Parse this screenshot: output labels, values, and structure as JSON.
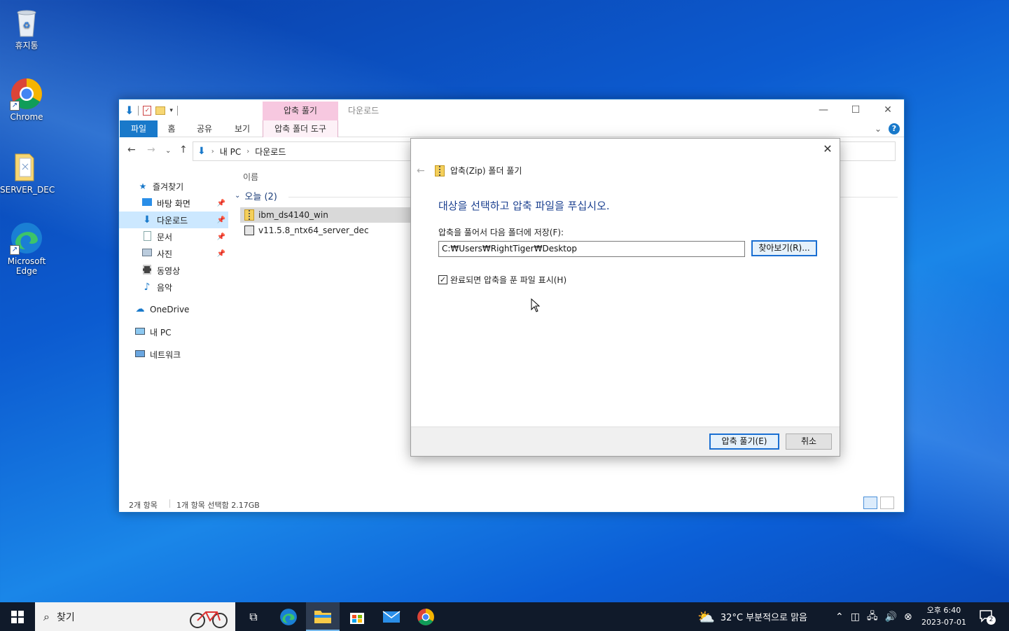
{
  "desktop": {
    "icons": [
      {
        "label": "휴지통"
      },
      {
        "label": "Chrome"
      },
      {
        "label": "SERVER_DEC"
      },
      {
        "label": "Microsoft Edge"
      }
    ]
  },
  "explorer": {
    "title": "다운로드",
    "context_tab_head": "압축 풀기",
    "tabs": {
      "file": "파일",
      "home": "홈",
      "share": "공유",
      "view": "보기",
      "context": "압축 폴더 도구"
    },
    "address": {
      "pc": "내 PC",
      "folder": "다운로드"
    },
    "nav": {
      "quick_access": "즐겨찾기",
      "desktop": "바탕 화면",
      "downloads": "다운로드",
      "documents": "문서",
      "pictures": "사진",
      "videos": "동영상",
      "music": "음악",
      "onedrive": "OneDrive",
      "this_pc": "내 PC",
      "network": "네트워크"
    },
    "column_name": "이름",
    "group_label": "오늘 (2)",
    "files": [
      {
        "name": "ibm_ds4140_win"
      },
      {
        "name": "v11.5.8_ntx64_server_dec"
      }
    ],
    "status": {
      "count": "2개 항목",
      "selection": "1개 항목 선택함 2.17GB"
    }
  },
  "dialog": {
    "title": "압축(Zip) 폴더 풀기",
    "heading": "대상을 선택하고 압축 파일을 푸십시오.",
    "path_label": "압축을 풀어서 다음 폴더에 저장(F):",
    "path_value": "C:₩Users₩RightTiger₩Desktop",
    "browse_label": "찾아보기(R)...",
    "checkbox_label": "완료되면 압축을 푼 파일 표시(H)",
    "checkbox_checked": true,
    "extract_label": "압축 풀기(E)",
    "cancel_label": "취소"
  },
  "taskbar": {
    "search_placeholder": "찾기",
    "weather": "32°C  부분적으로 맑음",
    "time": "오후 6:40",
    "date": "2023-07-01",
    "notification_count": "2"
  },
  "colors": {
    "accent": "#1979ca",
    "dialog_heading": "#1a3f8f",
    "selected_nav": "#cce8ff"
  }
}
